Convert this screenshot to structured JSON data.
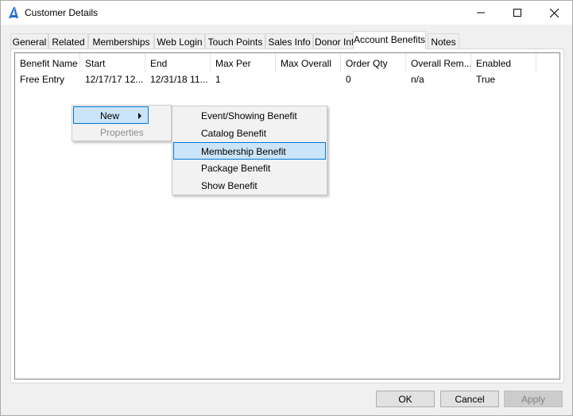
{
  "window": {
    "title": "Customer Details",
    "app_icon": "a-logo-icon"
  },
  "tabs": [
    "General",
    "Related",
    "Memberships",
    "Web Login",
    "Touch Points",
    "Sales Info",
    "Donor Info",
    "Account Benefits",
    "Notes"
  ],
  "active_tab": "Account Benefits",
  "listview": {
    "columns": [
      "Benefit Name",
      "Start",
      "End",
      "Max Per",
      "Max Overall",
      "Order Qty",
      "Overall Rem...",
      "Enabled"
    ],
    "rows": [
      [
        "Free Entry",
        "12/17/17 12...",
        "12/31/18 11...",
        "1",
        "",
        "0",
        "n/a",
        "True"
      ]
    ]
  },
  "context_menu": {
    "items": [
      {
        "label": "New",
        "has_submenu": true,
        "highlighted": true
      },
      {
        "label": "Properties",
        "disabled": true
      }
    ]
  },
  "submenu": {
    "items": [
      {
        "label": "Event/Showing Benefit"
      },
      {
        "label": "Catalog Benefit"
      },
      {
        "label": "Membership Benefit",
        "highlighted": true
      },
      {
        "label": "Package Benefit"
      },
      {
        "label": "Show Benefit"
      }
    ]
  },
  "buttons": {
    "ok": "OK",
    "cancel": "Cancel",
    "apply": "Apply"
  },
  "colors": {
    "highlight": "#cce4f7",
    "highlight_border": "#0078d7",
    "logo": "#1e6fd0"
  }
}
